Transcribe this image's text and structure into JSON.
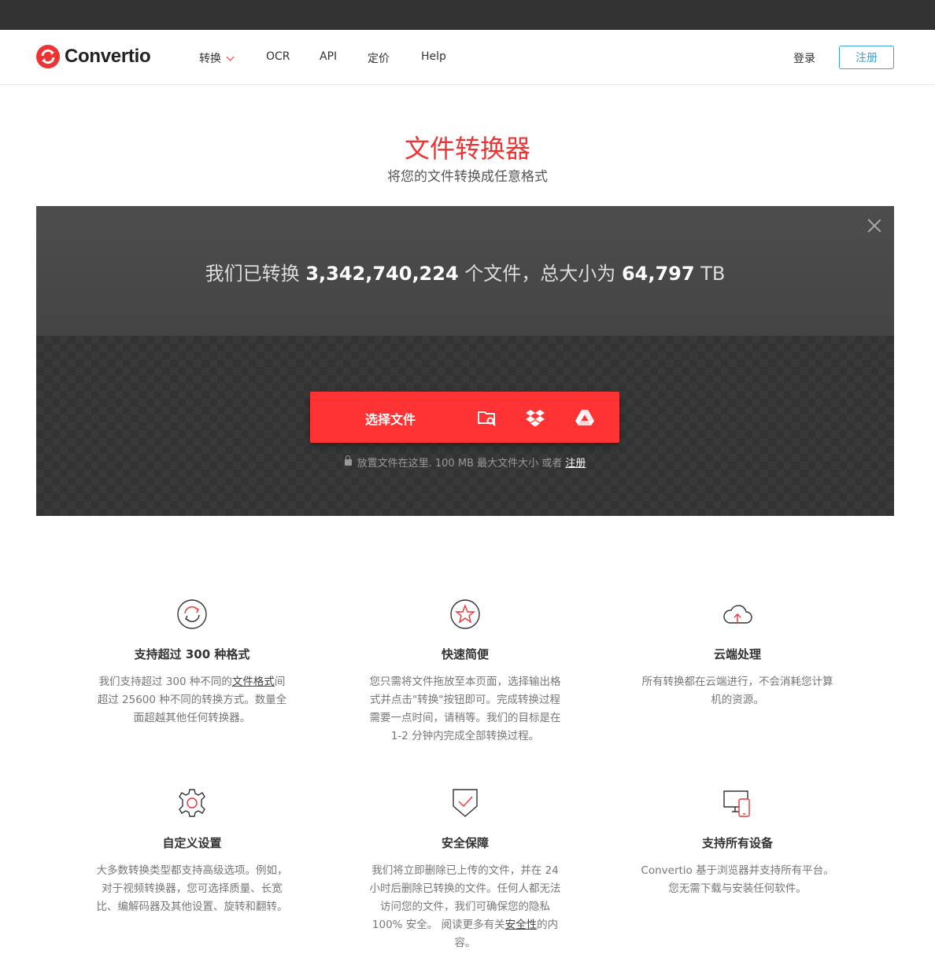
{
  "brand": {
    "name": "Convertio",
    "accent": "#ee3333"
  },
  "nav": {
    "items": [
      {
        "label": "转换",
        "has_dropdown": true
      },
      {
        "label": "OCR"
      },
      {
        "label": "API"
      },
      {
        "label": "定价"
      },
      {
        "label": "Help"
      }
    ],
    "login_label": "登录",
    "signup_label": "注册"
  },
  "hero": {
    "title": "文件转换器",
    "subtitle": "将您的文件转换成任意格式"
  },
  "stats": {
    "prefix": "我们已转换",
    "files_count": "3,342,740,224",
    "middle": "个文件，总大小为",
    "total_size": "64,797",
    "unit": "TB"
  },
  "upload": {
    "choose_label": "选择文件",
    "icons": [
      "folder-search-icon",
      "dropbox-icon",
      "google-drive-icon"
    ],
    "note": "放置文件在这里. 100 MB 最大文件大小 或者",
    "note_link": "注册"
  },
  "features": [
    {
      "icon": "refresh-icon",
      "title": "支持超过 300 种格式",
      "text_before": "我们支持超过 300 种不同的",
      "link": "文件格式",
      "text_after": "间超过 25600 种不同的转换方式。数量全面超越其他任何转换器。"
    },
    {
      "icon": "star-icon",
      "title": "快速简便",
      "text_before": "您只需将文件拖放至本页面，选择输出格式并点击\"转换\"按钮即可。完成转换过程需要一点时间，请稍等。我们的目标是在 1-2 分钟内完成全部转换过程。",
      "link": "",
      "text_after": ""
    },
    {
      "icon": "cloud-upload-icon",
      "title": "云端处理",
      "text_before": "所有转换都在云端进行，不会消耗您计算机的资源。",
      "link": "",
      "text_after": ""
    },
    {
      "icon": "gear-icon",
      "title": "自定义设置",
      "text_before": "大多数转换类型都支持高级选项。例如，对于视频转换器，您可选择质量、长宽比、编解码器及其他设置、旋转和翻转。",
      "link": "",
      "text_after": ""
    },
    {
      "icon": "shield-check-icon",
      "title": "安全保障",
      "text_before": "我们将立即删除已上传的文件，并在 24 小时后删除已转换的文件。任何人都无法访问您的文件，我们可确保您的隐私 100% 安全。 阅读更多有关",
      "link": "安全性",
      "text_after": "的内容。"
    },
    {
      "icon": "devices-icon",
      "title": "支持所有设备",
      "text_before": "Convertio 基于浏览器并支持所有平台。您无需下载与安装任何软件。",
      "link": "",
      "text_after": ""
    }
  ]
}
